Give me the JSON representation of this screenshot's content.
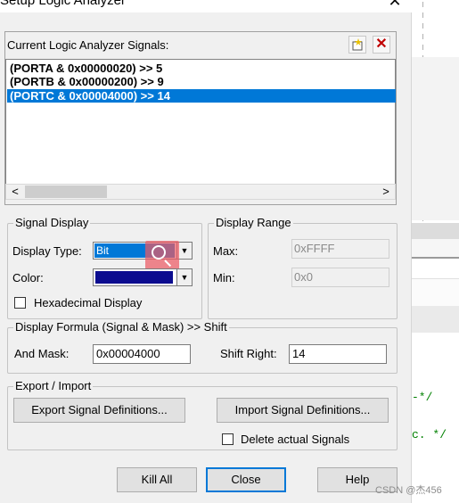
{
  "window": {
    "title": "Setup Logic Analyzer",
    "close_glyph": "✕"
  },
  "signals": {
    "label": "Current Logic Analyzer Signals:",
    "new_icon": "new-signal-icon",
    "delete_icon": "delete-signal-icon",
    "items": [
      {
        "text": "(PORTA & 0x00000020) >> 5",
        "selected": false
      },
      {
        "text": "(PORTB & 0x00000200) >> 9",
        "selected": false
      },
      {
        "text": "(PORTC & 0x00004000) >> 14",
        "selected": true
      }
    ],
    "scroll_left": "<",
    "scroll_right": ">"
  },
  "signal_display": {
    "legend": "Signal Display",
    "display_type_label": "Display Type:",
    "display_type_value": "Bit",
    "color_label": "Color:",
    "color_value": "#0b0c8f",
    "hex_label": "Hexadecimal Display",
    "hex_checked": false
  },
  "display_range": {
    "legend": "Display Range",
    "max_label": "Max:",
    "max_value": "0xFFFF",
    "min_label": "Min:",
    "min_value": "0x0"
  },
  "formula": {
    "legend": "Display Formula (Signal & Mask) >> Shift",
    "and_mask_label": "And Mask:",
    "and_mask_value": "0x00004000",
    "shift_right_label": "Shift Right:",
    "shift_right_value": "14"
  },
  "export_import": {
    "legend": "Export / Import",
    "export_label": "Export Signal Definitions...",
    "import_label": "Import Signal Definitions...",
    "delete_actual_label": "Delete actual Signals",
    "delete_actual_checked": false
  },
  "buttons": {
    "kill_all": "Kill All",
    "close": "Close",
    "help": "Help"
  },
  "background_editor": {
    "code_line_1": "-*/",
    "code_line_2": "c. */"
  },
  "watermark": "CSDN @杰456",
  "colors": {
    "selection": "#0078d7",
    "accent_overlay": "#eb5a64",
    "code_comment": "#008000"
  }
}
